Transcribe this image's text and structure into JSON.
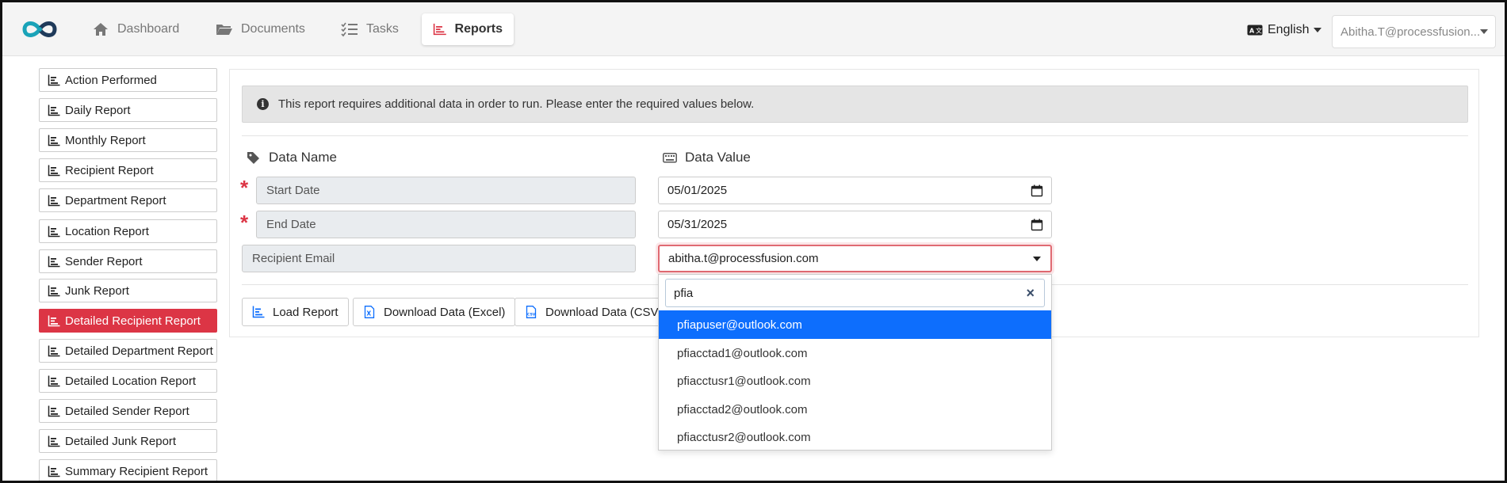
{
  "nav": {
    "tabs": [
      {
        "label": "Dashboard",
        "icon": "home-icon"
      },
      {
        "label": "Documents",
        "icon": "folder-icon"
      },
      {
        "label": "Tasks",
        "icon": "tasks-icon"
      },
      {
        "label": "Reports",
        "icon": "chart-icon"
      }
    ],
    "active_tab": "Reports",
    "language": "English",
    "user": "Abitha.T@processfusion..."
  },
  "sidebar": {
    "items": [
      {
        "label": "Action Performed"
      },
      {
        "label": "Daily Report"
      },
      {
        "label": "Monthly Report"
      },
      {
        "label": "Recipient Report"
      },
      {
        "label": "Department Report"
      },
      {
        "label": "Location Report"
      },
      {
        "label": "Sender Report"
      },
      {
        "label": "Junk Report"
      },
      {
        "label": "Detailed Recipient Report"
      },
      {
        "label": "Detailed Department Report"
      },
      {
        "label": "Detailed Location Report"
      },
      {
        "label": "Detailed Sender Report"
      },
      {
        "label": "Detailed Junk Report"
      },
      {
        "label": "Summary Recipient Report"
      }
    ],
    "active_item": "Detailed Recipient Report"
  },
  "main": {
    "alert": "This report requires additional data in order to run. Please enter the required values below.",
    "data_name_header": "Data Name",
    "data_value_header": "Data Value",
    "rows": [
      {
        "name": "Start Date",
        "value": "05/01/2025",
        "required": true
      },
      {
        "name": "End Date",
        "value": "05/31/2025",
        "required": true
      },
      {
        "name": "Recipient Email",
        "value": "abitha.t@processfusion.com",
        "required": false
      }
    ],
    "required_marker": "*",
    "buttons": {
      "load": "Load Report",
      "excel": "Download Data (Excel)",
      "csv": "Download Data (CSV)"
    }
  },
  "dropdown": {
    "search_value": "pfia",
    "clear": "×",
    "options": [
      "pfiapuser@outlook.com",
      "pfiacctad1@outlook.com",
      "pfiacctusr1@outlook.com",
      "pfiacctad2@outlook.com",
      "pfiacctusr2@outlook.com"
    ],
    "highlighted": "pfiapuser@outlook.com"
  },
  "colors": {
    "accent": "#dc3545",
    "highlight": "#0d6efd",
    "logo_teal": "#1aa3b8",
    "logo_navy": "#1f3a5a"
  }
}
